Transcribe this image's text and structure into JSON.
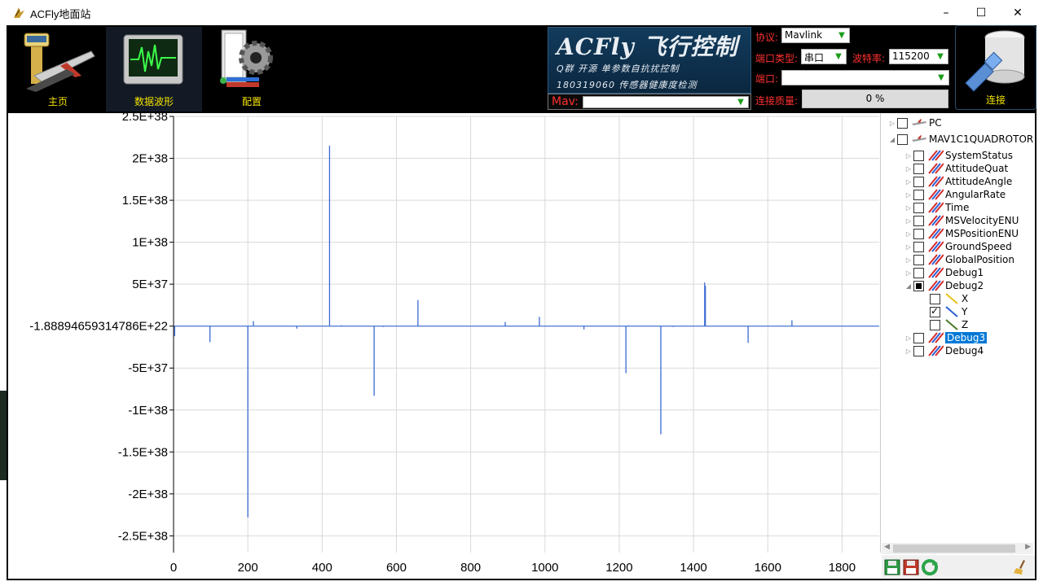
{
  "window": {
    "title": "ACFly地面站",
    "minimize": "–",
    "maximize": "☐",
    "close": "✕"
  },
  "toolbar": {
    "home_label": "主页",
    "waveform_label": "数据波形",
    "config_label": "配置",
    "connect_label": "连接"
  },
  "brand": {
    "line1": "ACFly 飞行控制",
    "line2": "Q群  开源 单参数自抗扰控制",
    "line3": "180319060  传感器健康度检测"
  },
  "connection": {
    "mav_label": "Mav:",
    "mav_value": "",
    "protocol_label": "协议:",
    "protocol_value": "Mavlink",
    "port_type_label": "端口类型:",
    "port_type_value": "串口",
    "baud_label": "波特率:",
    "baud_value": "115200",
    "port_label": "端口:",
    "port_value": "",
    "quality_label": "连接质量:",
    "quality_value": "0  %"
  },
  "tree": {
    "nodes": [
      {
        "label": "PC",
        "level": 0,
        "expander": "▷",
        "check": "none",
        "icon": "plane"
      },
      {
        "label": "MAV1C1QUADROTOR",
        "level": 0,
        "expander": "◢",
        "check": "none",
        "icon": "plane"
      },
      {
        "label": "SystemStatus",
        "level": 1,
        "expander": "▷",
        "check": "none",
        "icon": "multi"
      },
      {
        "label": "AttitudeQuat",
        "level": 1,
        "expander": "▷",
        "check": "none",
        "icon": "multi"
      },
      {
        "label": "AttitudeAngle",
        "level": 1,
        "expander": "▷",
        "check": "none",
        "icon": "multi"
      },
      {
        "label": "AngularRate",
        "level": 1,
        "expander": "▷",
        "check": "none",
        "icon": "multi"
      },
      {
        "label": "Time",
        "level": 1,
        "expander": "▷",
        "check": "none",
        "icon": "multi"
      },
      {
        "label": "MSVelocityENU",
        "level": 1,
        "expander": "▷",
        "check": "none",
        "icon": "multi"
      },
      {
        "label": "MSPositionENU",
        "level": 1,
        "expander": "▷",
        "check": "none",
        "icon": "multi"
      },
      {
        "label": "GroundSpeed",
        "level": 1,
        "expander": "▷",
        "check": "none",
        "icon": "multi"
      },
      {
        "label": "GlobalPosition",
        "level": 1,
        "expander": "▷",
        "check": "none",
        "icon": "multi"
      },
      {
        "label": "Debug1",
        "level": 1,
        "expander": "▷",
        "check": "none",
        "icon": "multi"
      },
      {
        "label": "Debug2",
        "level": 1,
        "expander": "◢",
        "check": "partial",
        "icon": "multi"
      },
      {
        "label": "X",
        "level": 2,
        "expander": "",
        "check": "none",
        "icon": "yellow"
      },
      {
        "label": "Y",
        "level": 2,
        "expander": "",
        "check": "checked",
        "icon": "blue"
      },
      {
        "label": "Z",
        "level": 2,
        "expander": "",
        "check": "none",
        "icon": "green"
      },
      {
        "label": "Debug3",
        "level": 1,
        "expander": "▷",
        "check": "none",
        "icon": "multi",
        "selected": true
      },
      {
        "label": "Debug4",
        "level": 1,
        "expander": "▷",
        "check": "none",
        "icon": "multi"
      }
    ]
  },
  "colors": {
    "series": "#3a6ad4",
    "label_red": "#ff3030",
    "label_yellow": "#f3e200",
    "selection": "#0078d7"
  },
  "chart_data": {
    "type": "line",
    "title": "",
    "xlabel": "",
    "ylabel": "",
    "xlim": [
      0,
      1900
    ],
    "ylim": [
      -2.7e+38,
      2.5e+38
    ],
    "grid": true,
    "x_ticks": [
      0,
      200,
      400,
      600,
      800,
      1000,
      1200,
      1400,
      1600,
      1800
    ],
    "y_ticks": [
      2.5e+38,
      2e+38,
      1.5e+38,
      1e+38,
      5e+37,
      -1.88894659314786e+22,
      -5e+37,
      -1e+38,
      -1.5e+38,
      -2e+38,
      -2.5e+38
    ],
    "y_tick_labels": [
      "2.5E+38",
      "2E+38",
      "1.5E+38",
      "1E+38",
      "5E+37",
      "-1.88894659314786E+22",
      "-5E+37",
      "-1E+38",
      "-1.5E+38",
      "-2E+38",
      "-2.5E+38"
    ],
    "series": [
      {
        "color": "#3a6ad4",
        "points": [
          [
            3,
            -1.2e+37
          ],
          [
            98,
            -1.9e+37
          ],
          [
            200,
            -2.28e+38
          ],
          [
            215,
            6e+36
          ],
          [
            332,
            -3e+36
          ],
          [
            420,
            2.15e+38
          ],
          [
            452,
            1e+36
          ],
          [
            540,
            -8.3e+37
          ],
          [
            565,
            -1e+36
          ],
          [
            658,
            3.1e+37
          ],
          [
            893,
            5e+36
          ],
          [
            985,
            1.1e+37
          ],
          [
            1105,
            -4e+36
          ],
          [
            1218,
            -5.6e+37
          ],
          [
            1225,
            1e+36
          ],
          [
            1312,
            -1.29e+38
          ],
          [
            1345,
            -1e+36
          ],
          [
            1430,
            5.2e+37
          ],
          [
            1432,
            4.8e+37
          ],
          [
            1547,
            -2e+37
          ],
          [
            1665,
            7e+36
          ]
        ]
      }
    ]
  }
}
